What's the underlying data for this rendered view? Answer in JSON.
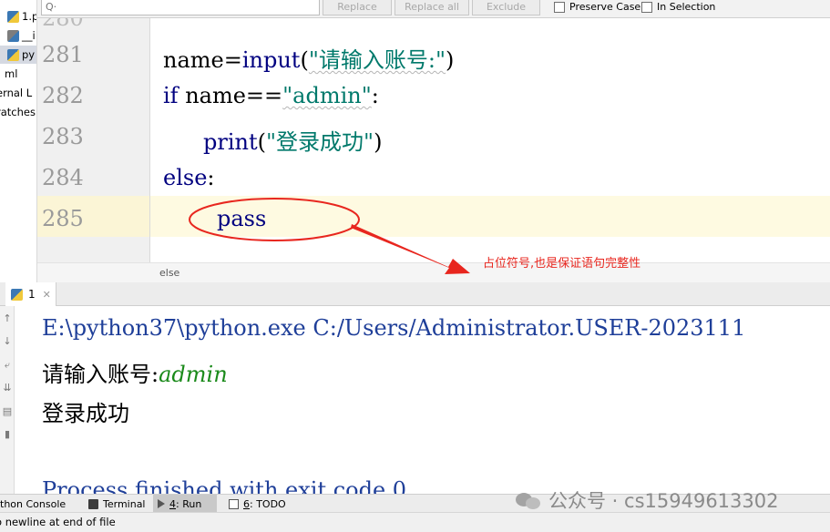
{
  "sidebar": {
    "items": [
      {
        "label": "1.p",
        "icon": "python-file-icon",
        "selected": false
      },
      {
        "label": "__i",
        "icon": "package-icon",
        "selected": false
      },
      {
        "label": "py",
        "icon": "python-file-icon",
        "selected": true
      },
      {
        "label": "ml",
        "icon": "",
        "selected": false
      },
      {
        "label": "ernal L",
        "icon": "",
        "selected": false
      },
      {
        "label": "ratches",
        "icon": "",
        "selected": false
      }
    ]
  },
  "findbar": {
    "search_placeholder": "Q·",
    "replace_label": "Replace",
    "replace_all_label": "Replace all",
    "exclude_label": "Exclude",
    "preserve_case_label": "Preserve Case",
    "in_selection_label": "In Selection"
  },
  "editor": {
    "line_numbers": [
      "281",
      "282",
      "283",
      "284",
      "285"
    ],
    "lines": [
      {
        "plain": "name=",
        "func": "input",
        "open": "(",
        "string": "\"请输入账号:\"",
        "close": ")"
      },
      {
        "keyword": "if",
        "plain": " name==",
        "string": "\"admin\"",
        "tail": ":"
      },
      {
        "func": "print",
        "open": "(",
        "string": "\"登录成功\"",
        "close": ")"
      },
      {
        "keyword": "else",
        "tail": ":"
      },
      {
        "keyword": "pass"
      }
    ],
    "breadcrumb": "else"
  },
  "run": {
    "tab_label": "1",
    "console": {
      "command": "E:\\python37\\python.exe C:/Users/Administrator.USER-2023111",
      "prompt": "请输入账号:",
      "user_input": "admin",
      "output": "登录成功",
      "finished": "Process finished with exit code 0"
    }
  },
  "toolstrip": {
    "python_console": "thon Console",
    "terminal": "Terminal",
    "run_num": "4",
    "run_label": ": Run",
    "todo_num": "6",
    "todo_label": ": TODO"
  },
  "status": {
    "message": "o newline at end of file"
  },
  "annotation": {
    "text": "占位符号,也是保证语句完整性",
    "color": "#e8261e"
  },
  "watermark": {
    "text": "公众号 · cs15949613302"
  }
}
